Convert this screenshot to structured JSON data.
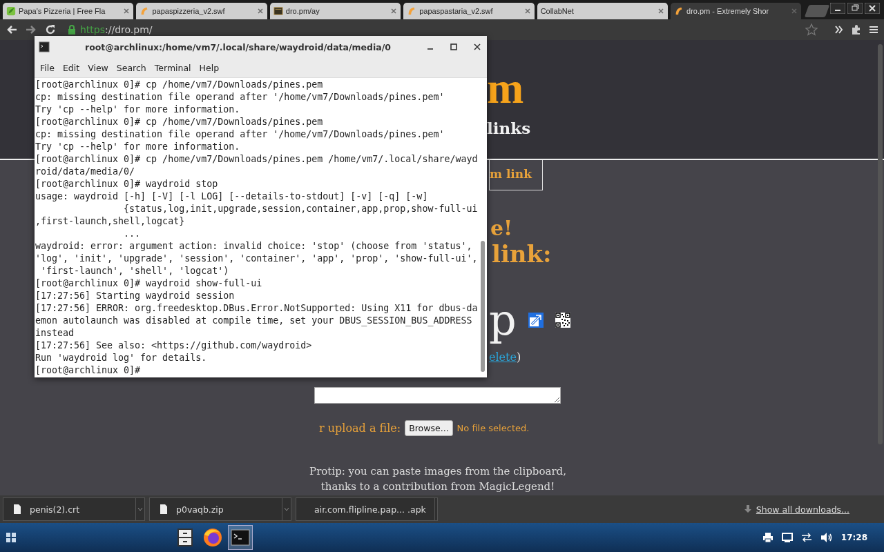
{
  "browser": {
    "tabs": [
      {
        "title": "Papa's Pizzeria | Free Fla",
        "selected": false
      },
      {
        "title": "papaspizzeria_v2.swf",
        "selected": false
      },
      {
        "title": "dro.pm/ay",
        "selected": false
      },
      {
        "title": "papaspastaria_v2.swf",
        "selected": false
      },
      {
        "title": "CollabNet",
        "selected": false
      },
      {
        "title": "dro.pm - Extremely Shor",
        "selected": true
      }
    ],
    "url": {
      "scheme": "https",
      "rest": "://dro.pm/"
    }
  },
  "page": {
    "logo": "m",
    "tagline": "links",
    "nav_link": "m link",
    "heading_1": "e!",
    "heading_2": "link:",
    "short_code": "p",
    "delete_link": "elete",
    "delete_close": ")",
    "upload_label": "r upload a file:",
    "browse_button": "Browse...",
    "file_status": "No file selected.",
    "protip": [
      "Protip: you can paste images from the clipboard,",
      "thanks to a contribution from MagicLegend!"
    ]
  },
  "terminal": {
    "title": "root@archlinux:/home/vm7/.local/share/waydroid/data/media/0",
    "menu": [
      "File",
      "Edit",
      "View",
      "Search",
      "Terminal",
      "Help"
    ],
    "lines": [
      "[root@archlinux 0]# cp /home/vm7/Downloads/pines.pem",
      "cp: missing destination file operand after '/home/vm7/Downloads/pines.pem'",
      "Try 'cp --help' for more information.",
      "[root@archlinux 0]# cp /home/vm7/Downloads/pines.pem",
      "cp: missing destination file operand after '/home/vm7/Downloads/pines.pem'",
      "Try 'cp --help' for more information.",
      "[root@archlinux 0]# cp /home/vm7/Downloads/pines.pem /home/vm7/.local/share/wayd",
      "roid/data/media/0/",
      "[root@archlinux 0]# waydroid stop",
      "usage: waydroid [-h] [-V] [-l LOG] [--details-to-stdout] [-v] [-q] [-w]",
      "                {status,log,init,upgrade,session,container,app,prop,show-full-ui",
      ",first-launch,shell,logcat}",
      "                ...",
      "waydroid: error: argument action: invalid choice: 'stop' (choose from 'status',",
      "'log', 'init', 'upgrade', 'session', 'container', 'app', 'prop', 'show-full-ui',",
      " 'first-launch', 'shell', 'logcat')",
      "[root@archlinux 0]# waydroid show-full-ui",
      "[17:27:56] Starting waydroid session",
      "[17:27:56] ERROR: org.freedesktop.DBus.Error.NotSupported: Using X11 for dbus-da",
      "emon autolaunch was disabled at compile time, set your DBUS_SESSION_BUS_ADDRESS",
      "instead",
      "[17:27:56] See also: <https://github.com/waydroid>",
      "Run 'waydroid log' for details.",
      "[root@archlinux 0]#"
    ]
  },
  "downloads": {
    "items": [
      "penis(2).crt",
      "p0vaqb.zip",
      "air.com.flipline.pap... .apk"
    ],
    "show_all": "Show all downloads..."
  },
  "taskbar": {
    "apps": [
      {
        "kind": "files",
        "selected": false
      },
      {
        "kind": "firefox",
        "selected": false
      },
      {
        "kind": "terminal",
        "selected": true
      }
    ],
    "clock": "17:28"
  }
}
